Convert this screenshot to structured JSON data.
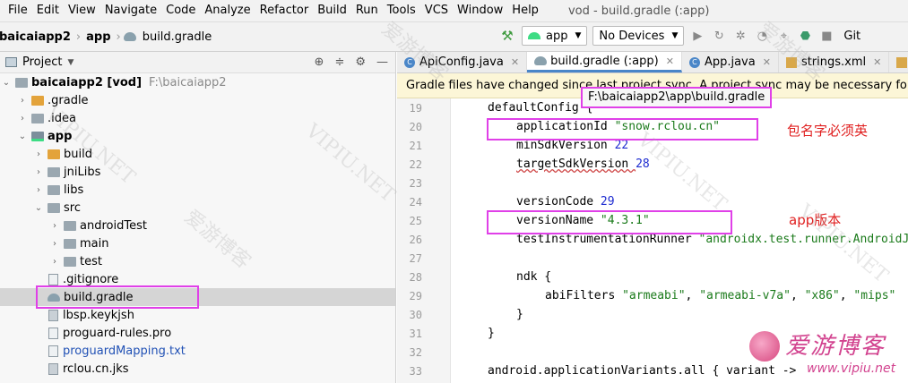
{
  "menu": [
    "File",
    "Edit",
    "View",
    "Navigate",
    "Code",
    "Analyze",
    "Refactor",
    "Build",
    "Run",
    "Tools",
    "VCS",
    "Window",
    "Help"
  ],
  "window_title": "vod - build.gradle (:app)",
  "breadcrumb": [
    "baicaiapp2",
    "app",
    "build.gradle"
  ],
  "toolbar": {
    "config": "app",
    "device": "No Devices",
    "git": "Git"
  },
  "project": {
    "title": "Project",
    "rows": [
      {
        "label": "baicaiapp2 [vod]",
        "extra": "F:\\baicaiapp2"
      },
      {
        "label": ".gradle"
      },
      {
        "label": ".idea"
      },
      {
        "label": "app"
      },
      {
        "label": "build"
      },
      {
        "label": "jniLibs"
      },
      {
        "label": "libs"
      },
      {
        "label": "src"
      },
      {
        "label": "androidTest"
      },
      {
        "label": "main"
      },
      {
        "label": "test"
      },
      {
        "label": ".gitignore"
      },
      {
        "label": "build.gradle"
      },
      {
        "label": "lbsp.keykjsh"
      },
      {
        "label": "proguard-rules.pro"
      },
      {
        "label": "proguardMapping.txt"
      },
      {
        "label": "rclou.cn.jks"
      }
    ]
  },
  "tabs": [
    "ApiConfig.java",
    "build.gradle (:app)",
    "App.java",
    "strings.xml",
    "activ"
  ],
  "banner": "Gradle files have changed since last project sync. A project sync may be necessary for the I",
  "tooltip": "F:\\baicaiapp2\\app\\build.gradle",
  "code": {
    "line_numbers": [
      "19",
      "20",
      "21",
      "22",
      "23",
      "24",
      "25",
      "26",
      "27",
      "28",
      "29",
      "30",
      "31",
      "32",
      "33"
    ],
    "l19": "defaultConfig {",
    "l20_key": "applicationId ",
    "l20_val": "\"snow.rclou.cn\"",
    "l21_key": "minSdkVersion ",
    "l21_val": "22",
    "l22_key": "targetSdkVersion ",
    "l22_val": "28",
    "l24_key": "versionCode ",
    "l24_val": "29",
    "l25_key": "versionName ",
    "l25_val": "\"4.3.1\"",
    "l26_key": "testInstrumentationRunner ",
    "l26_val": "\"androidx.test.runner.AndroidJ",
    "l28": "ndk {",
    "l29_key": "abiFilters ",
    "l29_v1": "\"armeabi\"",
    "l29_v2": "\"armeabi-v7a\"",
    "l29_v3": "\"x86\"",
    "l29_v4": "\"mips\"",
    "l30": "}",
    "l31": "}",
    "l33": "android.applicationVariants.all { variant ->"
  },
  "annotations": {
    "package_note": "包名字必须英",
    "version_note": "app版本"
  },
  "watermark": {
    "text_cn": "爱游博客",
    "text_en": "VIPIU.NET",
    "logo_cn": "爱游博客",
    "logo_url": "www.vipiu.net"
  },
  "colors": {
    "highlight": "#e040e8",
    "note": "#e02020",
    "accent": "#4a86c8"
  }
}
